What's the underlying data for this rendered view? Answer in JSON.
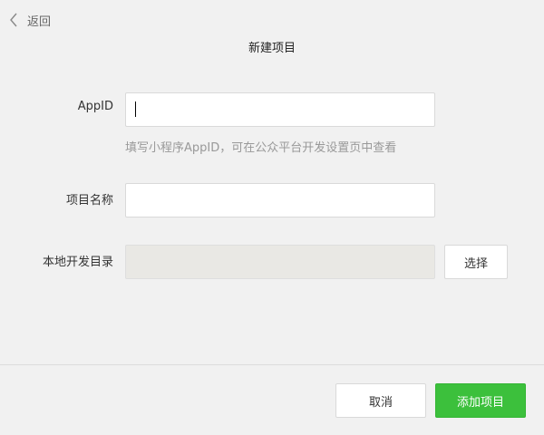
{
  "header": {
    "back_label": "返回",
    "back_icon": "chevron-left-icon",
    "title": "新建项目"
  },
  "form": {
    "appid": {
      "label": "AppID",
      "value": "",
      "hint": "填写小程序AppID，可在公众平台开发设置页中查看"
    },
    "project_name": {
      "label": "项目名称",
      "value": ""
    },
    "local_dir": {
      "label": "本地开发目录",
      "value": "",
      "choose_label": "选择"
    }
  },
  "footer": {
    "cancel_label": "取消",
    "submit_label": "添加项目"
  },
  "colors": {
    "background": "#f1f1f1",
    "primary": "#3cc03c",
    "disabled_field": "#e9e8e4",
    "hint_text": "#999999"
  }
}
